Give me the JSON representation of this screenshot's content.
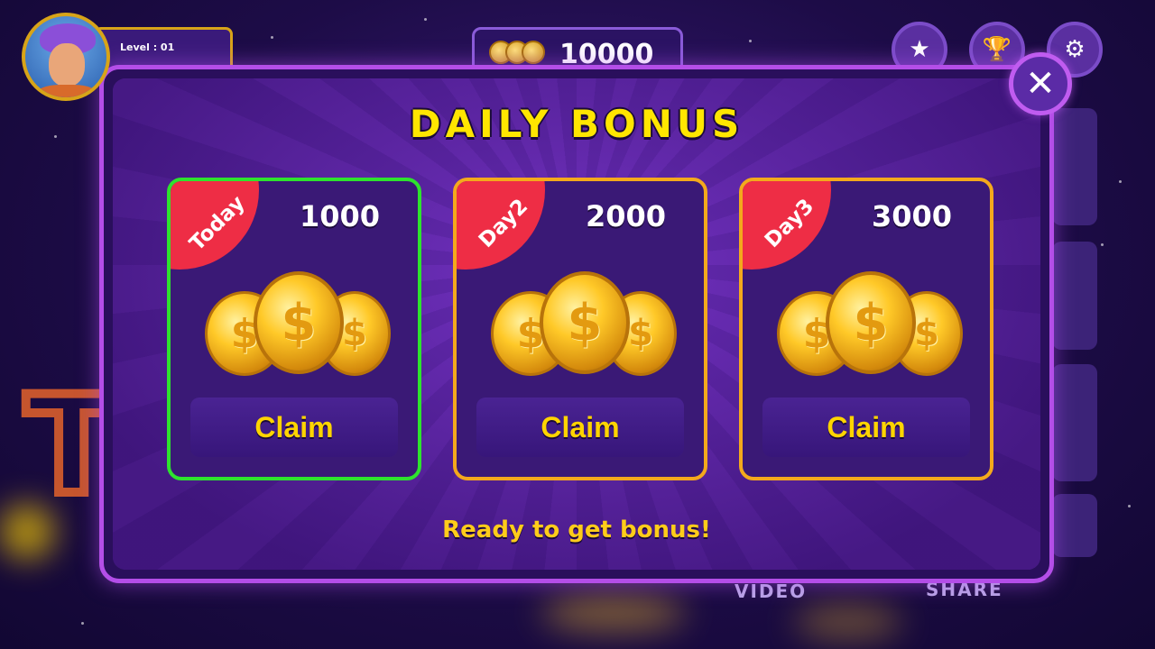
{
  "hud": {
    "level_label": "Level : 01",
    "coin_balance": "10000",
    "icons": [
      "star-icon",
      "trophy-icon",
      "gear-icon"
    ]
  },
  "background_labels": {
    "video": "VIDEO",
    "share": "SHARE"
  },
  "modal": {
    "title": "DAILY BONUS",
    "status_text": "Ready to get bonus!",
    "close_symbol": "✕",
    "cards": [
      {
        "tag": "Today",
        "amount": "1000",
        "claim_label": "Claim",
        "border_color": "#2ee32e"
      },
      {
        "tag": "Day2",
        "amount": "2000",
        "claim_label": "Claim",
        "border_color": "#f4a91c"
      },
      {
        "tag": "Day3",
        "amount": "3000",
        "claim_label": "Claim",
        "border_color": "#f4a91c"
      }
    ]
  },
  "colors": {
    "title": "#ffe600",
    "ribbon": "#ee2d45",
    "claim_text": "#ffd400",
    "modal_border": "#b44ee8"
  }
}
